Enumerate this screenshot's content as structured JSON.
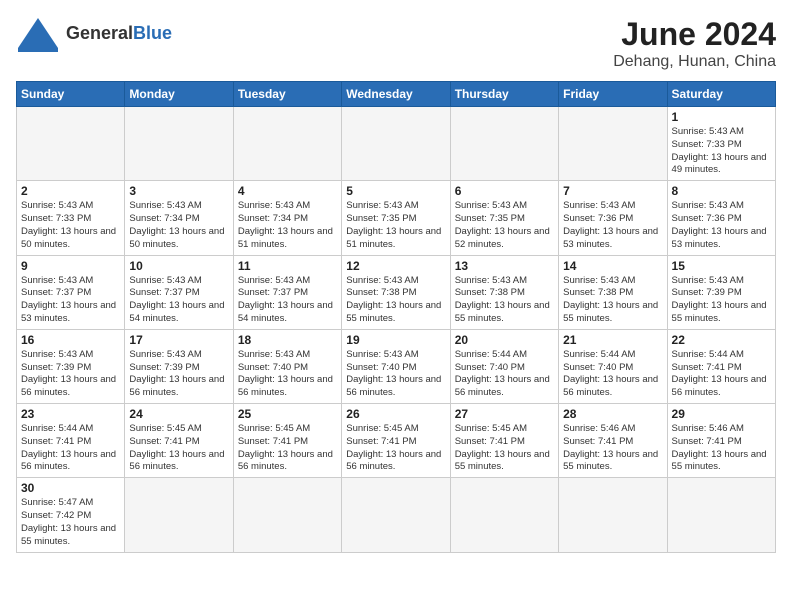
{
  "header": {
    "logo_general": "General",
    "logo_blue": "Blue",
    "month_title": "June 2024",
    "location": "Dehang, Hunan, China"
  },
  "weekdays": [
    "Sunday",
    "Monday",
    "Tuesday",
    "Wednesday",
    "Thursday",
    "Friday",
    "Saturday"
  ],
  "weeks": [
    [
      {
        "day": "",
        "info": ""
      },
      {
        "day": "",
        "info": ""
      },
      {
        "day": "",
        "info": ""
      },
      {
        "day": "",
        "info": ""
      },
      {
        "day": "",
        "info": ""
      },
      {
        "day": "",
        "info": ""
      },
      {
        "day": "1",
        "info": "Sunrise: 5:43 AM\nSunset: 7:33 PM\nDaylight: 13 hours\nand 49 minutes."
      }
    ],
    [
      {
        "day": "2",
        "info": "Sunrise: 5:43 AM\nSunset: 7:33 PM\nDaylight: 13 hours\nand 50 minutes."
      },
      {
        "day": "3",
        "info": "Sunrise: 5:43 AM\nSunset: 7:34 PM\nDaylight: 13 hours\nand 50 minutes."
      },
      {
        "day": "4",
        "info": "Sunrise: 5:43 AM\nSunset: 7:34 PM\nDaylight: 13 hours\nand 51 minutes."
      },
      {
        "day": "5",
        "info": "Sunrise: 5:43 AM\nSunset: 7:35 PM\nDaylight: 13 hours\nand 51 minutes."
      },
      {
        "day": "6",
        "info": "Sunrise: 5:43 AM\nSunset: 7:35 PM\nDaylight: 13 hours\nand 52 minutes."
      },
      {
        "day": "7",
        "info": "Sunrise: 5:43 AM\nSunset: 7:36 PM\nDaylight: 13 hours\nand 53 minutes."
      },
      {
        "day": "8",
        "info": "Sunrise: 5:43 AM\nSunset: 7:36 PM\nDaylight: 13 hours\nand 53 minutes."
      }
    ],
    [
      {
        "day": "9",
        "info": "Sunrise: 5:43 AM\nSunset: 7:37 PM\nDaylight: 13 hours\nand 53 minutes."
      },
      {
        "day": "10",
        "info": "Sunrise: 5:43 AM\nSunset: 7:37 PM\nDaylight: 13 hours\nand 54 minutes."
      },
      {
        "day": "11",
        "info": "Sunrise: 5:43 AM\nSunset: 7:37 PM\nDaylight: 13 hours\nand 54 minutes."
      },
      {
        "day": "12",
        "info": "Sunrise: 5:43 AM\nSunset: 7:38 PM\nDaylight: 13 hours\nand 55 minutes."
      },
      {
        "day": "13",
        "info": "Sunrise: 5:43 AM\nSunset: 7:38 PM\nDaylight: 13 hours\nand 55 minutes."
      },
      {
        "day": "14",
        "info": "Sunrise: 5:43 AM\nSunset: 7:38 PM\nDaylight: 13 hours\nand 55 minutes."
      },
      {
        "day": "15",
        "info": "Sunrise: 5:43 AM\nSunset: 7:39 PM\nDaylight: 13 hours\nand 55 minutes."
      }
    ],
    [
      {
        "day": "16",
        "info": "Sunrise: 5:43 AM\nSunset: 7:39 PM\nDaylight: 13 hours\nand 56 minutes."
      },
      {
        "day": "17",
        "info": "Sunrise: 5:43 AM\nSunset: 7:39 PM\nDaylight: 13 hours\nand 56 minutes."
      },
      {
        "day": "18",
        "info": "Sunrise: 5:43 AM\nSunset: 7:40 PM\nDaylight: 13 hours\nand 56 minutes."
      },
      {
        "day": "19",
        "info": "Sunrise: 5:43 AM\nSunset: 7:40 PM\nDaylight: 13 hours\nand 56 minutes."
      },
      {
        "day": "20",
        "info": "Sunrise: 5:44 AM\nSunset: 7:40 PM\nDaylight: 13 hours\nand 56 minutes."
      },
      {
        "day": "21",
        "info": "Sunrise: 5:44 AM\nSunset: 7:40 PM\nDaylight: 13 hours\nand 56 minutes."
      },
      {
        "day": "22",
        "info": "Sunrise: 5:44 AM\nSunset: 7:41 PM\nDaylight: 13 hours\nand 56 minutes."
      }
    ],
    [
      {
        "day": "23",
        "info": "Sunrise: 5:44 AM\nSunset: 7:41 PM\nDaylight: 13 hours\nand 56 minutes."
      },
      {
        "day": "24",
        "info": "Sunrise: 5:45 AM\nSunset: 7:41 PM\nDaylight: 13 hours\nand 56 minutes."
      },
      {
        "day": "25",
        "info": "Sunrise: 5:45 AM\nSunset: 7:41 PM\nDaylight: 13 hours\nand 56 minutes."
      },
      {
        "day": "26",
        "info": "Sunrise: 5:45 AM\nSunset: 7:41 PM\nDaylight: 13 hours\nand 56 minutes."
      },
      {
        "day": "27",
        "info": "Sunrise: 5:45 AM\nSunset: 7:41 PM\nDaylight: 13 hours\nand 55 minutes."
      },
      {
        "day": "28",
        "info": "Sunrise: 5:46 AM\nSunset: 7:41 PM\nDaylight: 13 hours\nand 55 minutes."
      },
      {
        "day": "29",
        "info": "Sunrise: 5:46 AM\nSunset: 7:41 PM\nDaylight: 13 hours\nand 55 minutes."
      }
    ],
    [
      {
        "day": "30",
        "info": "Sunrise: 5:47 AM\nSunset: 7:42 PM\nDaylight: 13 hours\nand 55 minutes."
      },
      {
        "day": "",
        "info": ""
      },
      {
        "day": "",
        "info": ""
      },
      {
        "day": "",
        "info": ""
      },
      {
        "day": "",
        "info": ""
      },
      {
        "day": "",
        "info": ""
      },
      {
        "day": "",
        "info": ""
      }
    ]
  ]
}
